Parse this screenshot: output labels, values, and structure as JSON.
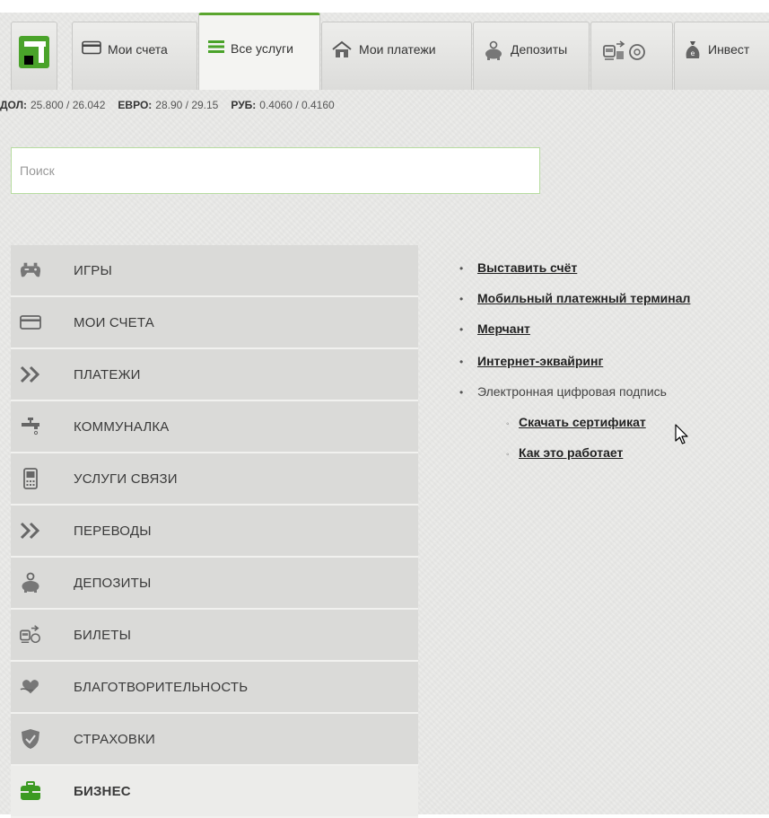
{
  "tabs": [
    {
      "label": "",
      "icon": "bank-logo-icon"
    },
    {
      "label": "Мои счета",
      "icon": "card-icon"
    },
    {
      "label": "Все услуги",
      "icon": "menu-lines-icon",
      "active": true
    },
    {
      "label": "Мои платежи",
      "icon": "house-icon"
    },
    {
      "label": "Депозиты",
      "icon": "piggy-bank-icon"
    },
    {
      "label": "",
      "icon": "tickets-icon"
    },
    {
      "label": "Инвест",
      "icon": "money-bag-icon"
    }
  ],
  "rates": {
    "usd_label": "ДОЛ:",
    "usd_value": "25.800 / 26.042",
    "eur_label": "ЕВРО:",
    "eur_value": "28.90 / 29.15",
    "rub_label": "РУБ:",
    "rub_value": "0.4060 / 0.4160"
  },
  "search": {
    "placeholder": "Поиск"
  },
  "menu": [
    {
      "label": "ИГРЫ",
      "icon": "gamepad-icon"
    },
    {
      "label": "МОИ СЧЕТА",
      "icon": "card-icon"
    },
    {
      "label": "ПЛАТЕЖИ",
      "icon": "double-chevron-icon"
    },
    {
      "label": "КОММУНАЛКА",
      "icon": "faucet-icon"
    },
    {
      "label": "УСЛУГИ СВЯЗИ",
      "icon": "phone-icon"
    },
    {
      "label": "ПЕРЕВОДЫ",
      "icon": "double-chevron-icon"
    },
    {
      "label": "ДЕПОЗИТЫ",
      "icon": "piggy-bank-icon"
    },
    {
      "label": "БИЛЕТЫ",
      "icon": "tickets-icon"
    },
    {
      "label": "БЛАГОТВОРИТЕЛЬНОСТЬ",
      "icon": "heart-hand-icon"
    },
    {
      "label": "СТРАХОВКИ",
      "icon": "shield-icon"
    },
    {
      "label": "БИЗНЕС",
      "icon": "briefcase-icon",
      "active": true
    }
  ],
  "links": {
    "invoice": "Выставить счёт",
    "mobile_terminal": "Мобильный платежный терминал",
    "merchant": "Мерчант",
    "acquiring": "Интернет-эквайринг",
    "e_signature": "Электронная цифровая подпись",
    "download_cert": "Скачать сертификат",
    "how_it_works": "Как это работает"
  },
  "colors": {
    "accent": "#5aa52e",
    "brand": "#4aa32a"
  }
}
